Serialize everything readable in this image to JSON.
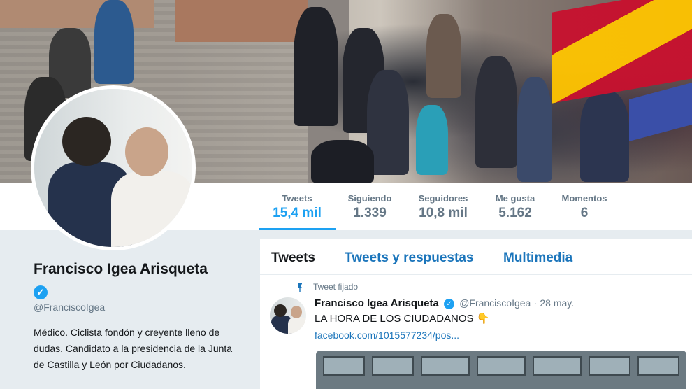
{
  "profile": {
    "name": "Francisco Igea Arisqueta",
    "handle": "@FranciscoIgea",
    "bio": "Médico. Ciclista fondón y creyente lleno de dudas. Candidato a la presidencia de la Junta de Castilla y León por Ciudadanos."
  },
  "stats": [
    {
      "label": "Tweets",
      "value": "15,4 mil"
    },
    {
      "label": "Siguiendo",
      "value": "1.339"
    },
    {
      "label": "Seguidores",
      "value": "10,8 mil"
    },
    {
      "label": "Me gusta",
      "value": "5.162"
    },
    {
      "label": "Momentos",
      "value": "6"
    }
  ],
  "tabs": [
    "Tweets",
    "Tweets y respuestas",
    "Multimedia"
  ],
  "tweet": {
    "pinned_label": "Tweet fijado",
    "name": "Francisco Igea Arisqueta",
    "handle": "@FranciscoIgea",
    "separator": "·",
    "date": "28 may.",
    "text": "LA HORA DE LOS CIUDADANOS 👇",
    "link": "facebook.com/1015577234/pos..."
  },
  "colors": {
    "accent": "#1da1f2",
    "link": "#1b75bb",
    "text": "#14171a",
    "muted": "#657786",
    "page_bg": "#e6ecf0"
  },
  "icons": {
    "verified": "verified-badge-icon",
    "pin": "pin-icon"
  }
}
